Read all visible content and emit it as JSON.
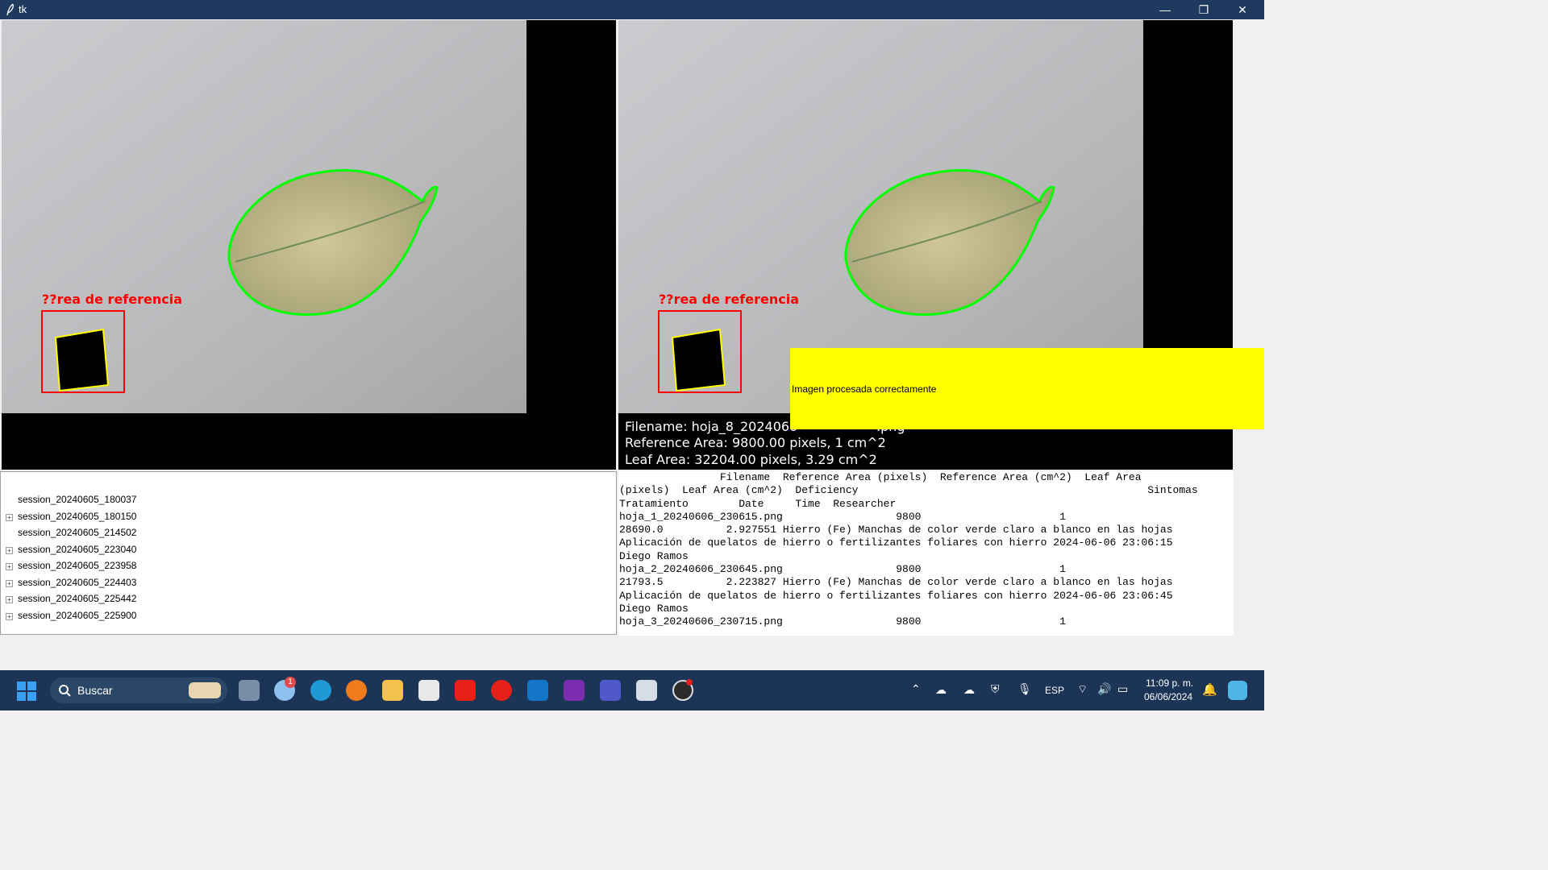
{
  "window": {
    "title": "tk",
    "minimize": "—",
    "restore": "❐",
    "close": "✕"
  },
  "left_panel": {
    "label": "??rea de referencia"
  },
  "right_panel": {
    "label": "??rea de referencia",
    "overlay": {
      "filename": "Filename: hoja_8_2024060",
      "filename_tail": ".png",
      "reference_area": "Reference Area: 9800.00 pixels, 1 cm^2",
      "leaf_area": "Leaf Area: 32204.00 pixels, 3.29 cm^2"
    }
  },
  "message": {
    "text": "Imagen procesada correctamente",
    "color": "#ffff00"
  },
  "sessions": [
    {
      "label": "session_20240605_180037",
      "expandable": false
    },
    {
      "label": "session_20240605_180150",
      "expandable": true
    },
    {
      "label": "session_20240605_214502",
      "expandable": false
    },
    {
      "label": "session_20240605_223040",
      "expandable": true
    },
    {
      "label": "session_20240605_223958",
      "expandable": true
    },
    {
      "label": "session_20240605_224403",
      "expandable": true
    },
    {
      "label": "session_20240605_225442",
      "expandable": true
    },
    {
      "label": "session_20240605_225900",
      "expandable": true
    }
  ],
  "results_text": {
    "lines": [
      "                Filename  Reference Area (pixels)  Reference Area (cm^2)  Leaf Area",
      "(pixels)  Leaf Area (cm^2)  Deficiency                                              Sintomas",
      "Tratamiento        Date     Time  Researcher",
      "hoja_1_20240606_230615.png                  9800                      1",
      "28690.0          2.927551 Hierro (Fe) Manchas de color verde claro a blanco en las hojas",
      "Aplicación de quelatos de hierro o fertilizantes foliares con hierro 2024-06-06 23:06:15",
      "Diego Ramos",
      "hoja_2_20240606_230645.png                  9800                      1",
      "21793.5          2.223827 Hierro (Fe) Manchas de color verde claro a blanco en las hojas",
      "Aplicación de quelatos de hierro o fertilizantes foliares con hierro 2024-06-06 23:06:45",
      "Diego Ramos",
      "hoja_3_20240606_230715.png                  9800                      1"
    ]
  },
  "taskbar": {
    "search_placeholder": "Buscar",
    "weather_badge": "1",
    "language": "ESP",
    "time": "11:09 p. m.",
    "date": "06/06/2024",
    "pinned_icons": [
      "task-view-icon",
      "weather-icon",
      "edge-icon",
      "firefox-icon",
      "file-explorer-icon",
      "store-icon",
      "youtube-icon",
      "youtube-music-icon",
      "outlook-icon",
      "onenote-icon",
      "teams-icon",
      "python-idle-icon",
      "obs-icon"
    ]
  },
  "colors": {
    "titlebar": "#1e3a5f",
    "taskbar": "#1c3556",
    "contour": "#00ff00",
    "reference_box": "#ff0000",
    "reference_contour": "#ffff00"
  }
}
